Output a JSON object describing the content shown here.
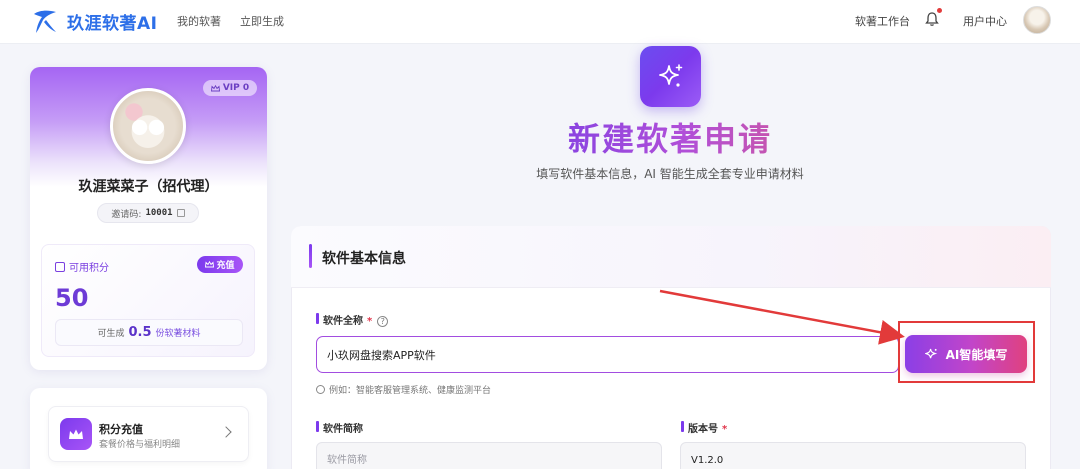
{
  "header": {
    "logo_text": "玖涯软著AI",
    "nav": [
      "我的软著",
      "立即生成"
    ],
    "workspace": "软著工作台",
    "user_center": "用户中心"
  },
  "profile": {
    "vip": "VIP 0",
    "name": "玖涯菜菜子（招代理）",
    "invite_label": "邀请码:",
    "invite_code": "10001",
    "points_label": "可用积分",
    "recharge": "充值",
    "points": "50",
    "gen_prefix": "可生成",
    "gen_count": "0.5",
    "gen_suffix": "份软著材料"
  },
  "menu": {
    "title": "积分充值",
    "subtitle": "套餐价格与福利明细"
  },
  "hero": {
    "title": "新建软著申请",
    "subtitle": "填写软件基本信息，AI 智能生成全套专业申请材料"
  },
  "form": {
    "section_title": "软件基本信息",
    "fullname_label": "软件全称",
    "required_mark": "*",
    "fullname_value": "小玖网盘搜索APP软件",
    "hint": "例如：智能客服管理系统、健康监测平台",
    "ai_button": "AI智能填写",
    "short_label": "软件简称",
    "short_placeholder": "软件简称",
    "version_label": "版本号",
    "version_value": "V1.2.0"
  },
  "colors": {
    "brand": "#2d6fe8",
    "accent": "#7c3aed",
    "annotation": "#e23a3a"
  },
  "icons": [
    "logo-icon",
    "bell-icon",
    "crown-icon",
    "copy-icon",
    "gift-icon",
    "sparkle-icon",
    "help-icon",
    "info-icon",
    "chevron-right-icon"
  ]
}
